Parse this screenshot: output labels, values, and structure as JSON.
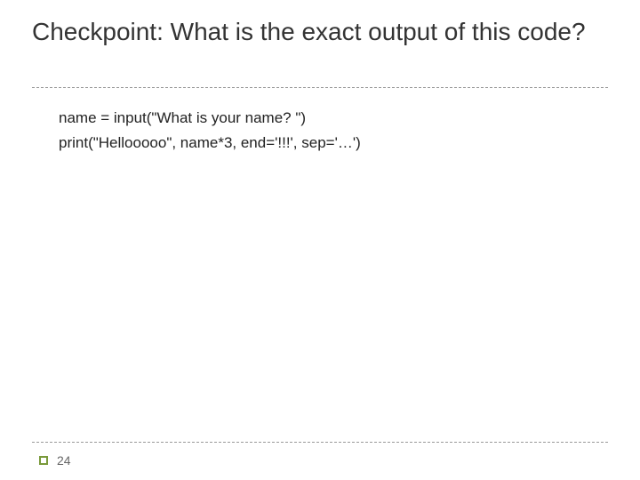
{
  "slide": {
    "title": "Checkpoint:  What is the exact output of this code?",
    "code": {
      "line1": "name = input(\"What is your name? \")",
      "line2": "print(\"Hellooooo\", name*3, end='!!!', sep='…')"
    },
    "page_number": "24"
  }
}
